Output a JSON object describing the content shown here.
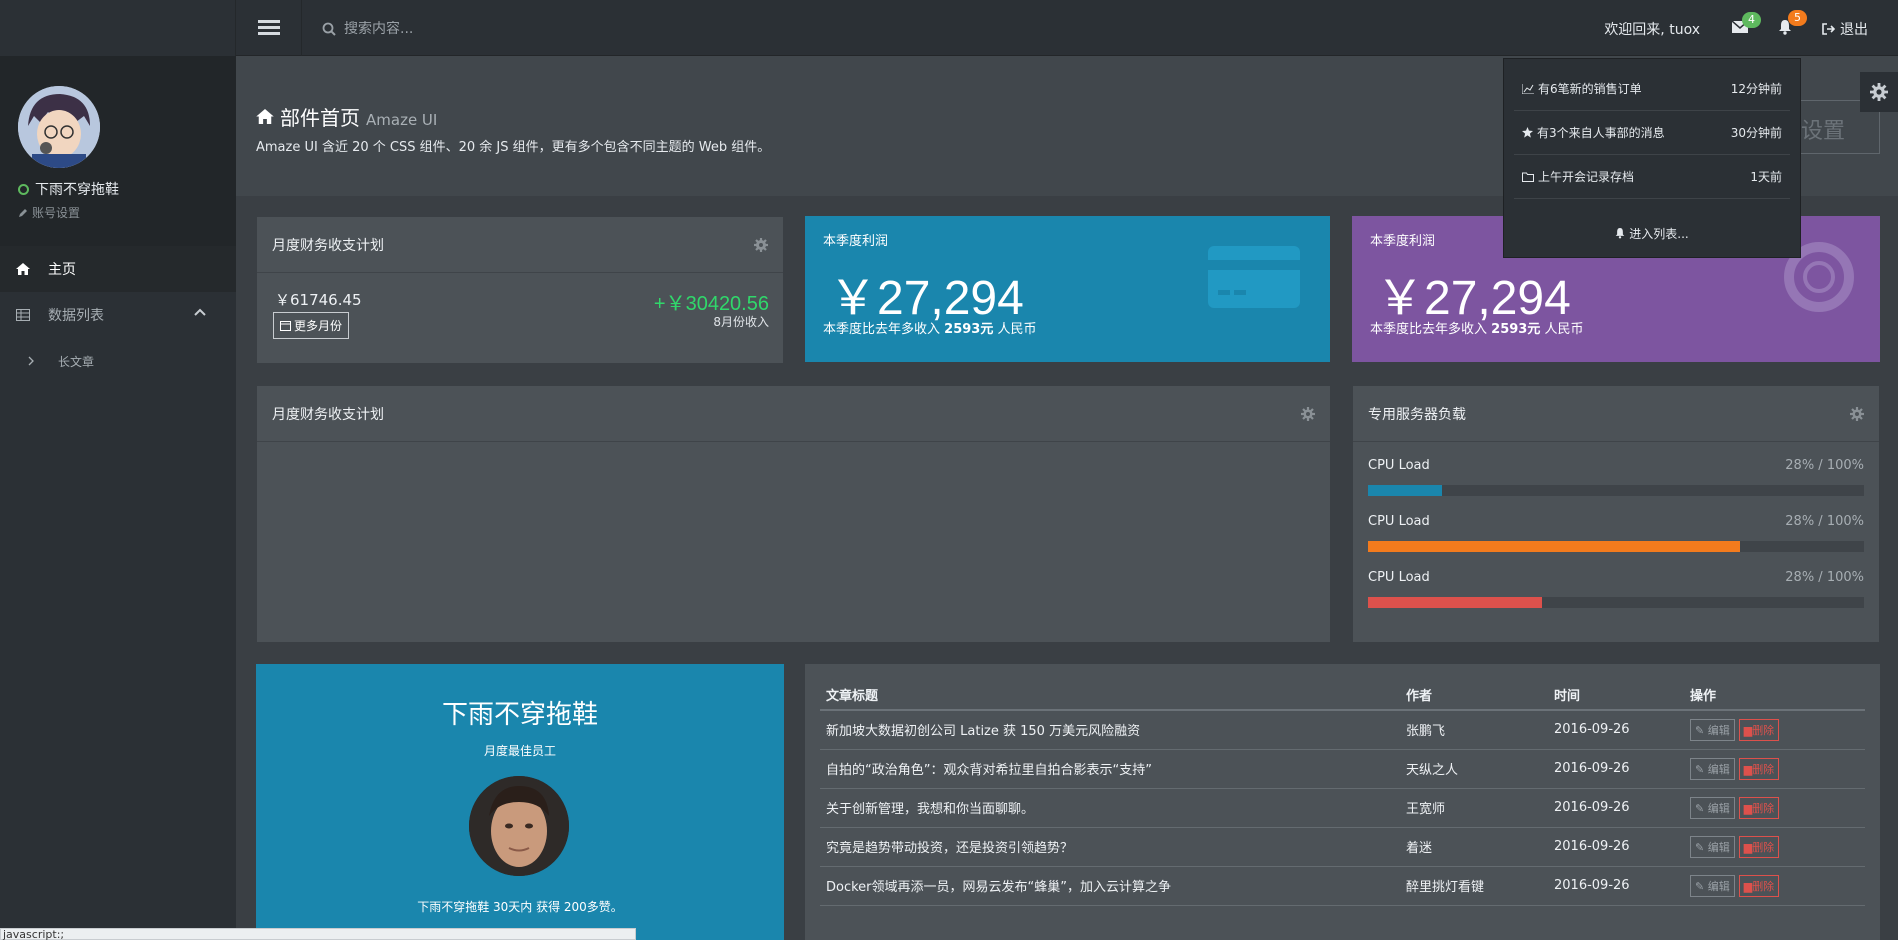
{
  "topbar": {
    "search_placeholder": "搜索内容...",
    "welcome": "欢迎回来, tuox",
    "mail_count": "4",
    "notify_count": "5",
    "logout": "退出"
  },
  "sidebar": {
    "username": "下雨不穿拖鞋",
    "account_settings": "账号设置",
    "items": [
      {
        "label": "主页"
      },
      {
        "label": "数据列表"
      },
      {
        "label": "长文章"
      }
    ]
  },
  "page": {
    "title": "部件首页",
    "subtitle": "Amaze UI",
    "description": "Amaze UI 含近 20 个 CSS 组件、20 余 JS 组件，更有多个包含不同主题的 Web 组件。",
    "settings_button": "设置"
  },
  "finance": {
    "title": "月度财务收支计划",
    "amount": "￥61746.45",
    "more_button": "更多月份",
    "income": "+￥30420.56",
    "income_label": "8月份收入"
  },
  "profit_cards": [
    {
      "title": "本季度利润",
      "value": "￥27,294",
      "sub_prefix": "本季度比去年多收入",
      "sub_value": "2593元",
      "sub_suffix": "人民币",
      "color": "#1a86ad"
    },
    {
      "title": "本季度利润",
      "value": "￥27,294",
      "sub_prefix": "本季度比去年多收入",
      "sub_value": "2593元",
      "sub_suffix": "人民币",
      "color": "#7d55a0"
    }
  ],
  "finance_chart_panel": {
    "title": "月度财务收支计划"
  },
  "server_load": {
    "title": "专用服务器负载",
    "rows": [
      {
        "label": "CPU Load",
        "value": "28% / 100%",
        "fill": 0.15,
        "color": "#1a86ad"
      },
      {
        "label": "CPU Load",
        "value": "28% / 100%",
        "fill": 0.75,
        "color": "#f37b1d"
      },
      {
        "label": "CPU Load",
        "value": "28% / 100%",
        "fill": 0.35,
        "color": "#dd514c"
      }
    ]
  },
  "employee": {
    "name": "下雨不穿拖鞋",
    "role": "月度最佳员工",
    "desc": "下雨不穿拖鞋 30天内 获得 200多赞。"
  },
  "articles": {
    "headers": [
      "文章标题",
      "作者",
      "时间",
      "操作"
    ],
    "edit_label": "编辑",
    "delete_label": "删除",
    "rows": [
      {
        "title": "新加坡大数据初创公司 Latize 获 150 万美元风险融资",
        "author": "张鹏飞",
        "date": "2016-09-26"
      },
      {
        "title": "自拍的“政治角色”：观众背对希拉里自拍合影表示“支持”",
        "author": "天纵之人",
        "date": "2016-09-26"
      },
      {
        "title": "关于创新管理，我想和你当面聊聊。",
        "author": "王宽师",
        "date": "2016-09-26"
      },
      {
        "title": "究竟是趋势带动投资，还是投资引领趋势？",
        "author": "着迷",
        "date": "2016-09-26"
      },
      {
        "title": "Docker领域再添一员，网易云发布“蜂巢”，加入云计算之争",
        "author": "醉里挑灯看键",
        "date": "2016-09-26"
      }
    ]
  },
  "notifications": {
    "items": [
      {
        "text": "有6笔新的销售订单",
        "time": "12分钟前",
        "icon": "line-chart-icon"
      },
      {
        "text": "有3个来自人事部的消息",
        "time": "30分钟前",
        "icon": "star-icon"
      },
      {
        "text": "上午开会记录存档",
        "time": "1天前",
        "icon": "folder-icon"
      }
    ],
    "footer": "进入列表..."
  },
  "statusbar": {
    "text": "javascript:;"
  }
}
